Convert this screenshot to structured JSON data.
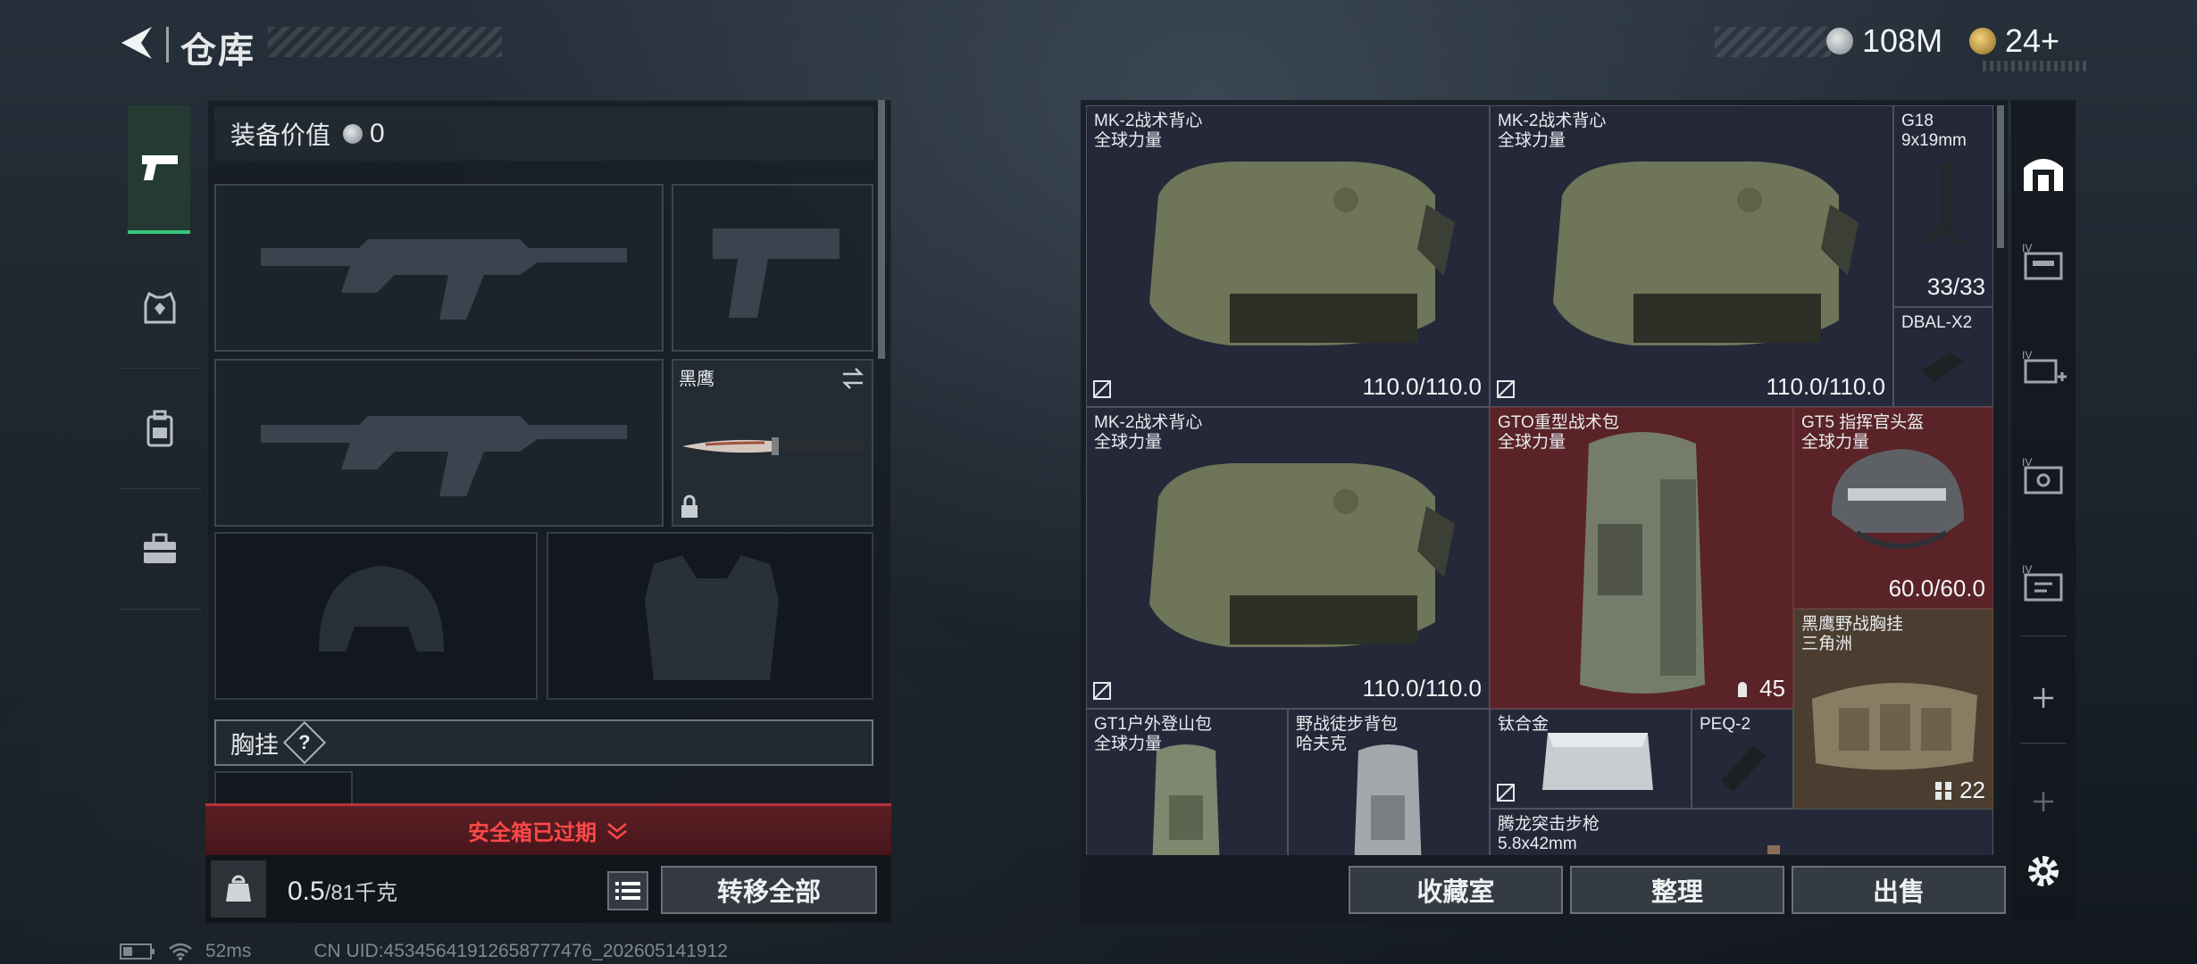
{
  "header": {
    "title": "仓库",
    "currency1": "108M",
    "currency2": "24+"
  },
  "left": {
    "equip_value_label": "装备价值",
    "equip_value": "0",
    "knife_name": "黑鹰",
    "chest_rig_label": "胸挂",
    "help": "?",
    "safe_expired": "安全箱已过期",
    "weight_current": "0.5",
    "weight_max": "/81千克",
    "transfer_all": "转移全部"
  },
  "grid": {
    "items": [
      {
        "name": "MK-2战术背心",
        "sub": "全球力量",
        "value": "110.0/110.0"
      },
      {
        "name": "MK-2战术背心",
        "sub": "全球力量",
        "value": "110.0/110.0"
      },
      {
        "name": "G18",
        "sub": "9x19mm",
        "value": "33/33"
      },
      {
        "name": "DBAL-X2"
      },
      {
        "name": "MK-2战术背心",
        "sub": "全球力量",
        "value": "110.0/110.0"
      },
      {
        "name": "GTO重型战术包",
        "sub": "全球力量",
        "value": "45"
      },
      {
        "name": "GT5 指挥官头盔",
        "sub": "全球力量",
        "value": "60.0/60.0"
      },
      {
        "name": "黑鹰野战胸挂",
        "sub": "三角洲",
        "value": "22"
      },
      {
        "name": "GT1户外登山包",
        "sub": "全球力量"
      },
      {
        "name": "野战徒步背包",
        "sub": "哈夫克"
      },
      {
        "name": "钛合金"
      },
      {
        "name": "PEQ-2"
      },
      {
        "name": "腾龙突击步枪",
        "sub": "5.8x42mm"
      }
    ]
  },
  "actions": {
    "collection": "收藏室",
    "organize": "整理",
    "sell": "出售"
  },
  "status": {
    "ping": "52ms",
    "uid": "CN UID:4534564191265877747​6_202605141912"
  },
  "colors": {
    "accent_green": "#38c77a",
    "alert_red": "#ff4848"
  }
}
